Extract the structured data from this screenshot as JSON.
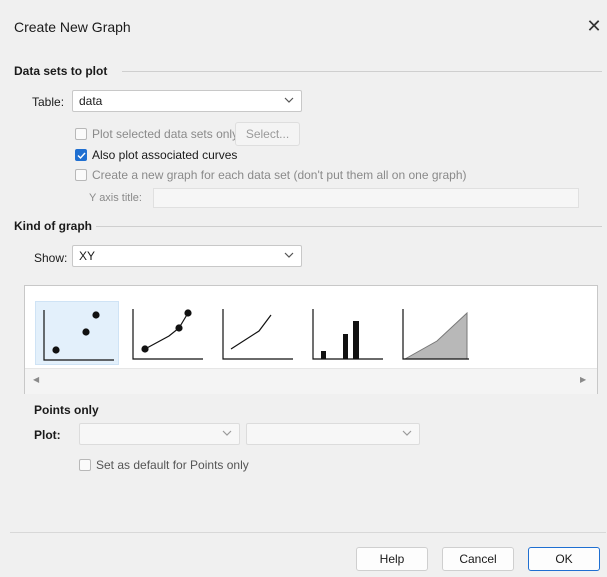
{
  "window": {
    "title": "Create New Graph",
    "close_glyph": "✕"
  },
  "data_sets": {
    "section_title": "Data sets to plot",
    "table_label": "Table:",
    "table_value": "data",
    "plot_selected_label": "Plot selected data sets only",
    "plot_selected_checked": false,
    "select_button": "Select...",
    "also_plot_label": "Also plot associated curves",
    "also_plot_checked": true,
    "new_graph_each_label": "Create a new graph for each data set (don't put them all on one graph)",
    "new_graph_each_checked": false,
    "y_axis_title_label": "Y axis title:",
    "y_axis_title_value": ""
  },
  "kind": {
    "section_title": "Kind of graph",
    "show_label": "Show:",
    "show_value": "XY",
    "gallery_icons": [
      "points-only-icon",
      "points-and-connecting-line-icon",
      "line-only-icon",
      "spikes-bar-icon",
      "area-fill-icon"
    ],
    "selected_index": 0,
    "scroll_left_glyph": "◀",
    "scroll_right_glyph": "▶"
  },
  "points_only": {
    "heading": "Points only",
    "plot_label": "Plot:",
    "plot_value_1": "",
    "plot_value_2": "",
    "default_label": "Set as default for Points only",
    "default_checked": false
  },
  "footer": {
    "help": "Help",
    "cancel": "Cancel",
    "ok": "OK"
  },
  "colors": {
    "accent": "#1f6fd1",
    "selected_tile": "#e3f0fb",
    "area_fill": "#b8b8b8"
  }
}
